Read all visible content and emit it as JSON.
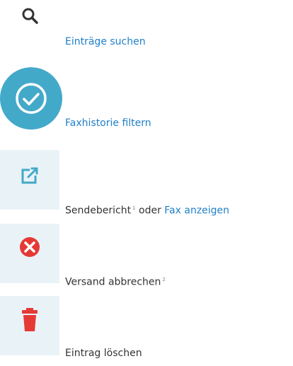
{
  "colors": {
    "link": "#1e7fc9",
    "teal": "#43a9c9",
    "light_bg": "#e9f3f7",
    "red": "#e53935"
  },
  "items": [
    {
      "icon": "search-icon",
      "link": "Einträge suchen"
    },
    {
      "icon": "check-circle-icon",
      "link": "Faxhistorie filtern"
    },
    {
      "icon": "external-link-icon",
      "text": "Sendebericht",
      "sup": "1",
      "mid": "oder",
      "link": "Fax anzeigen"
    },
    {
      "icon": "x-circle-icon",
      "text": "Versand abbrechen",
      "sup": "2"
    },
    {
      "icon": "trash-icon",
      "text": "Eintrag löschen"
    }
  ]
}
